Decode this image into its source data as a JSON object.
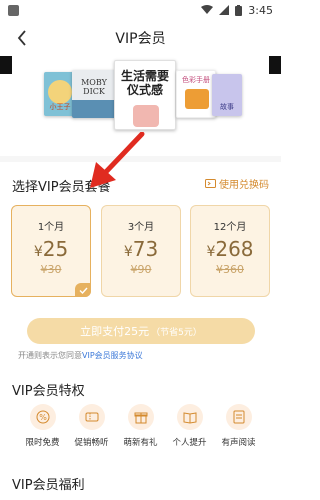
{
  "status_bar": {
    "time": "3:45"
  },
  "nav": {
    "title": "VIP会员"
  },
  "banner": {
    "center_book_title": "生活需要仪式感",
    "side_books": [
      "小王子",
      "MOBY DICK",
      "色彩手册",
      "故事"
    ]
  },
  "plans": {
    "section_title": "选择VIP会员套餐",
    "redeem_label": "使用兑换码",
    "items": [
      {
        "name": "1个月",
        "currency": "¥",
        "price": "25",
        "original": "¥30",
        "selected": true
      },
      {
        "name": "3个月",
        "currency": "¥",
        "price": "73",
        "original": "¥90",
        "selected": false
      },
      {
        "name": "12个月",
        "currency": "¥",
        "price": "268",
        "original": "¥360",
        "selected": false
      }
    ]
  },
  "pay": {
    "label": "立即支付25元",
    "save": "（节省5元）"
  },
  "agreement": {
    "prefix": "开通则表示您同意",
    "link": "VIP会员服务协议"
  },
  "privileges": {
    "section_title": "VIP会员特权",
    "items": [
      {
        "label": "限时免费",
        "icon": "percent-icon"
      },
      {
        "label": "促销畅听",
        "icon": "coupon-icon"
      },
      {
        "label": "萌新有礼",
        "icon": "gift-icon"
      },
      {
        "label": "个人提升",
        "icon": "book-icon"
      },
      {
        "label": "有声阅读",
        "icon": "audio-book-icon"
      }
    ]
  },
  "benefits": {
    "section_title": "VIP会员福利"
  },
  "colors": {
    "accent": "#e6b15f",
    "price": "#8a6a3a",
    "link": "#3b78d8",
    "arrow": "#e02b20"
  }
}
